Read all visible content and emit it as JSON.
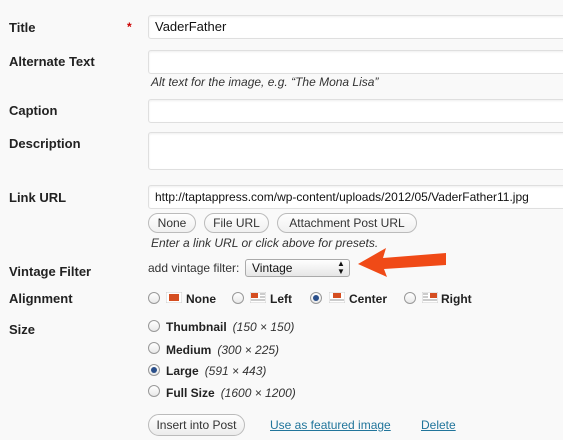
{
  "form": {
    "title": {
      "label": "Title",
      "required_mark": "*",
      "value": "VaderFather"
    },
    "alt_text": {
      "label": "Alternate Text",
      "value": "",
      "help": "Alt text for the image, e.g. “The Mona Lisa”"
    },
    "caption": {
      "label": "Caption",
      "value": ""
    },
    "description": {
      "label": "Description",
      "value": ""
    },
    "link_url": {
      "label": "Link URL",
      "value": "http://taptappress.com/wp-content/uploads/2012/05/VaderFather11.jpg",
      "presets": [
        "None",
        "File URL",
        "Attachment Post URL"
      ],
      "help": "Enter a link URL or click above for presets."
    },
    "vintage_filter": {
      "label": "Vintage Filter",
      "prefix": "add vintage filter:",
      "selected": "Vintage"
    },
    "alignment": {
      "label": "Alignment",
      "options": [
        "None",
        "Left",
        "Center",
        "Right"
      ],
      "selected": "Center"
    },
    "size": {
      "label": "Size",
      "options": [
        {
          "name": "Thumbnail",
          "dims": "(150 × 150)"
        },
        {
          "name": "Medium",
          "dims": "(300 × 225)"
        },
        {
          "name": "Large",
          "dims": "(591 × 443)"
        },
        {
          "name": "Full Size",
          "dims": "(1600 × 1200)"
        }
      ],
      "selected": "Large"
    },
    "actions": {
      "insert": "Insert into Post",
      "featured": "Use as featured image",
      "delete": "Delete"
    }
  },
  "colors": {
    "annotation_arrow": "#f04a17",
    "link": "#21759b",
    "required": "#cc0000",
    "align_icon": "#d54e21"
  }
}
